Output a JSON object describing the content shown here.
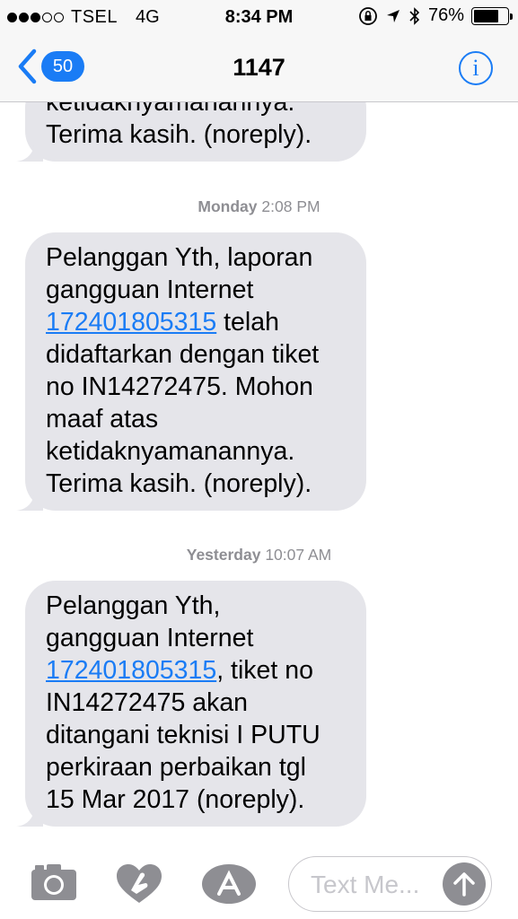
{
  "status_bar": {
    "carrier": "TSEL",
    "network": "4G",
    "time": "8:34 PM",
    "battery_percent": "76%",
    "battery_level": 0.76,
    "signal_bars": 3,
    "signal_total": 5
  },
  "nav": {
    "back_count": "50",
    "title": "1147",
    "info_icon": "info-icon"
  },
  "messages": [
    {
      "lines": [
        "ketidaknyamanannya.",
        "Terima kasih. (noreply)."
      ]
    },
    {
      "day": "Monday",
      "time": "2:08 PM",
      "lines": [
        "Pelanggan Yth, laporan",
        "gangguan Internet",
        "172401805315",
        "telah",
        "didaftarkan dengan tiket",
        "no IN14272475. Mohon",
        "maaf atas",
        "ketidaknyamanannya.",
        "Terima kasih. (noreply)."
      ]
    },
    {
      "day": "Yesterday",
      "time": "10:07 AM",
      "lines": [
        "Pelanggan Yth,",
        "gangguan Internet",
        "172401805315",
        ", tiket no",
        "IN14272475 akan",
        "ditangani teknisi I PUTU",
        "perkiraan perbaikan tgl",
        "15 Mar 2017 (noreply)."
      ]
    }
  ],
  "input": {
    "placeholder": "Text Message",
    "placeholder_visible": "Text Me..."
  },
  "colors": {
    "accent": "#1a7cf5",
    "bubble": "#e5e5ea",
    "timestamp": "#8e8e93"
  }
}
